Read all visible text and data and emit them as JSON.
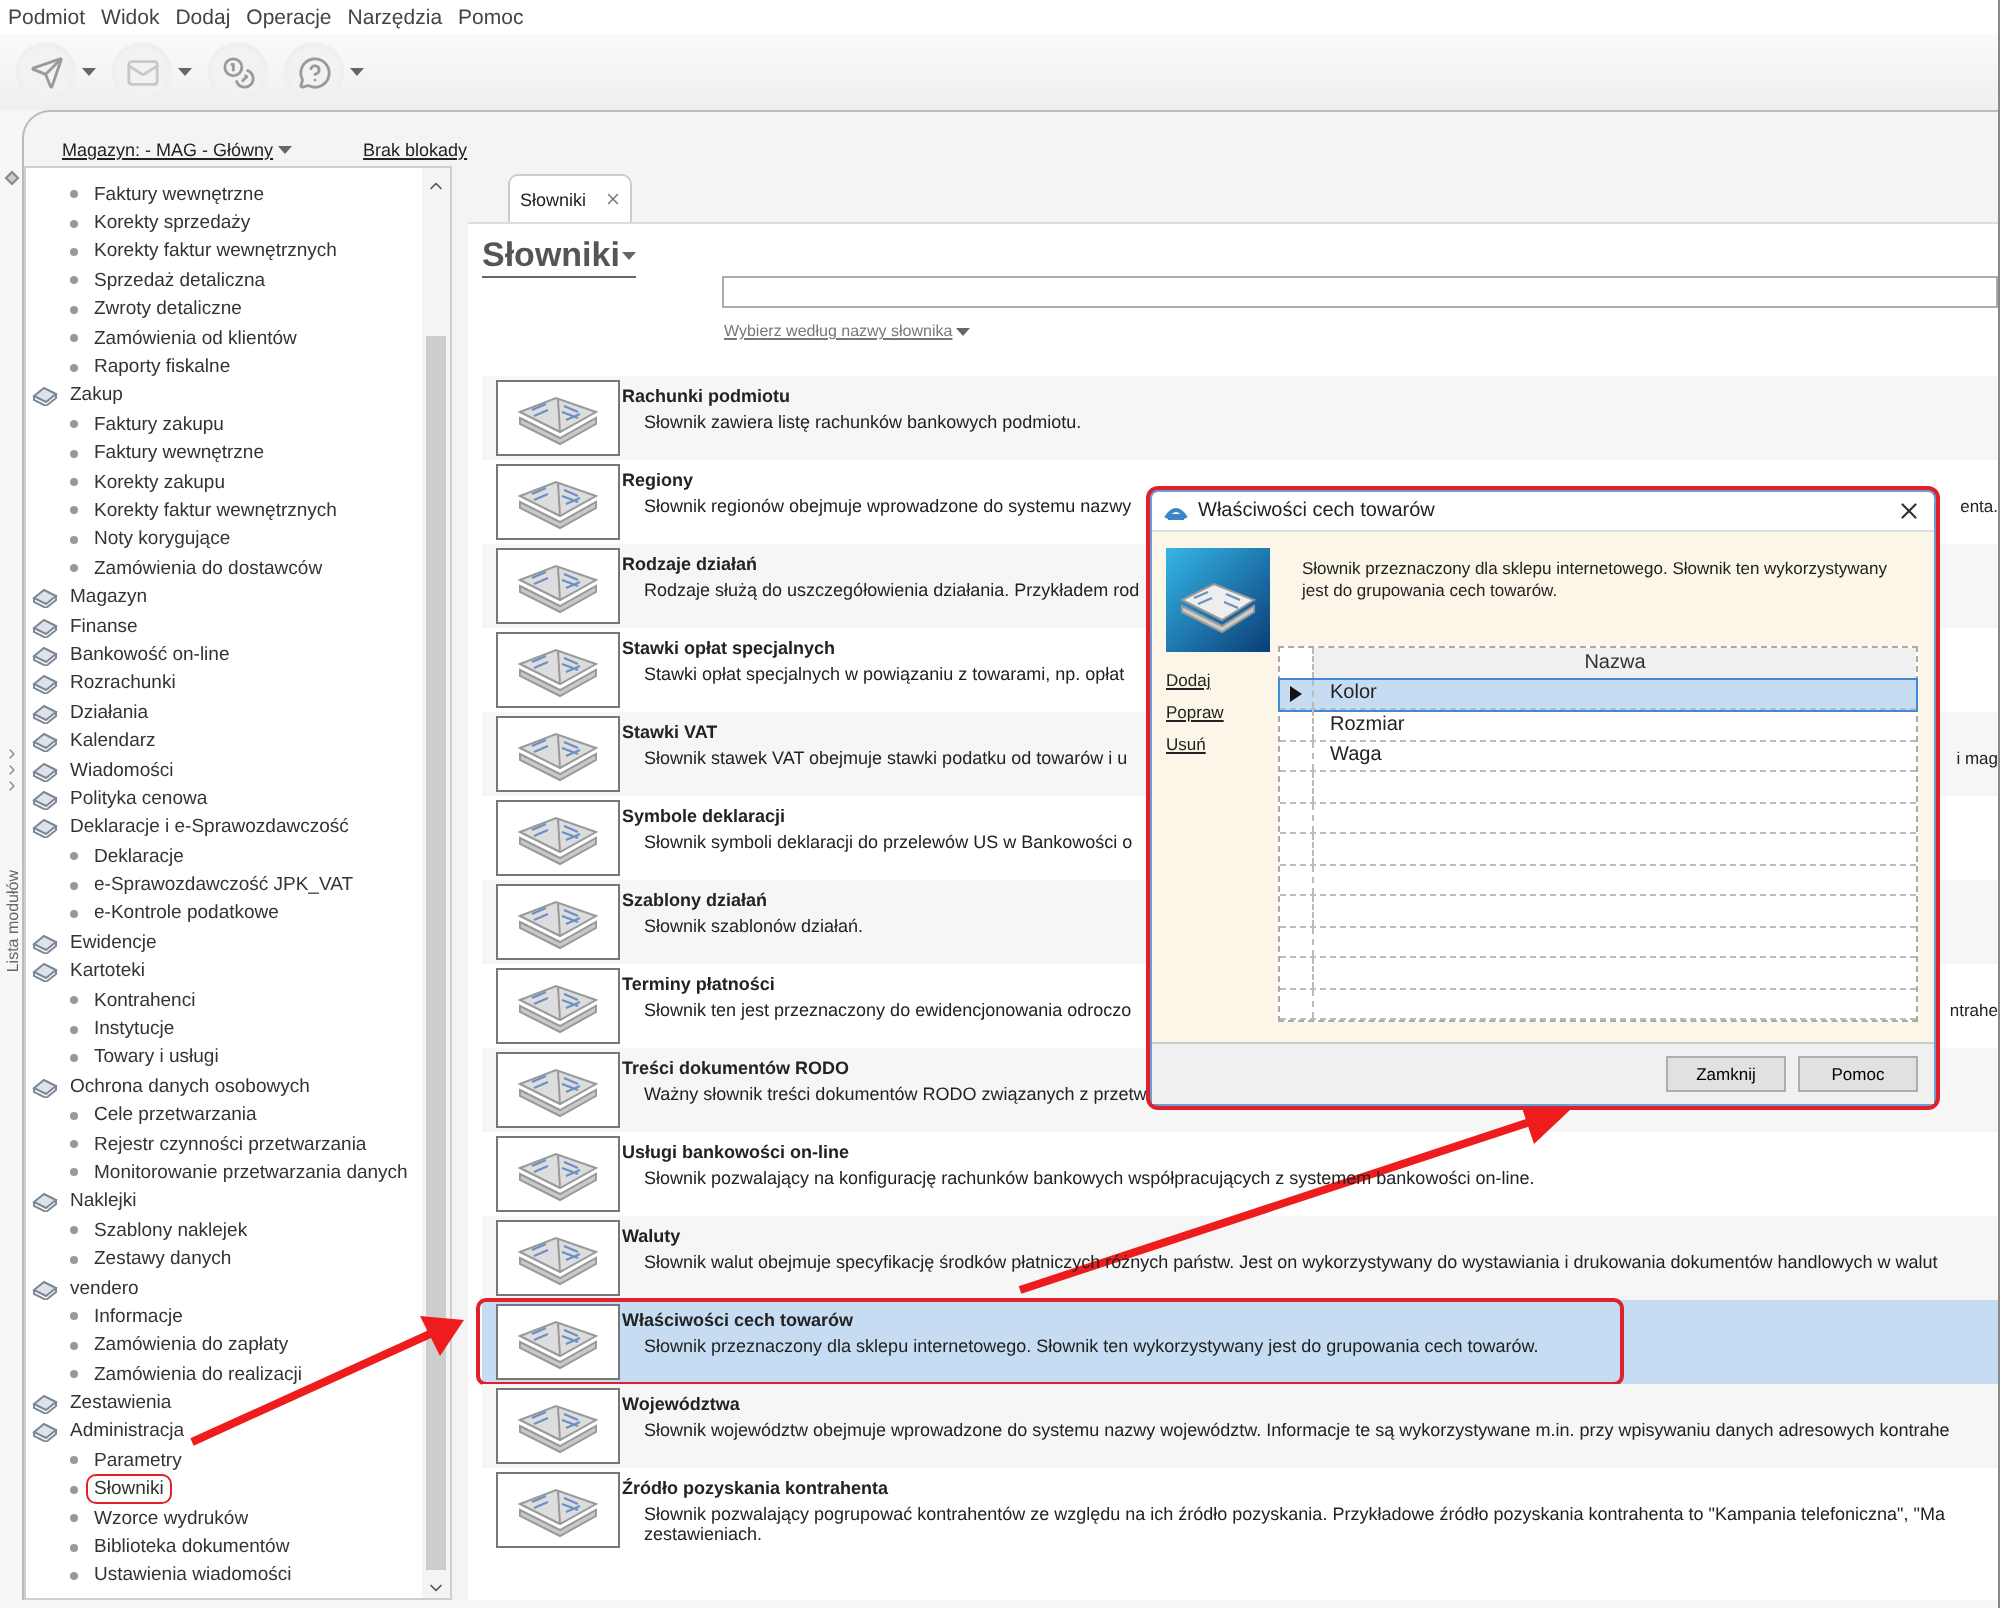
{
  "menu": [
    "Podmiot",
    "Widok",
    "Dodaj",
    "Operacje",
    "Narzędzia",
    "Pomoc"
  ],
  "toolbar": [
    {
      "kind": "send",
      "dropdown": true,
      "disabled": false
    },
    {
      "kind": "mail",
      "dropdown": true,
      "disabled": true
    },
    {
      "kind": "coins",
      "dropdown": false,
      "disabled": false
    },
    {
      "kind": "help",
      "dropdown": true,
      "disabled": false
    }
  ],
  "infobar": {
    "warehouse": "Magazyn: - MAG - Główny",
    "lock": "Brak blokady"
  },
  "sidebar": {
    "title": "Lista modułów",
    "tree": [
      {
        "children": [
          {
            "label": "Faktury wewnętrzne"
          },
          {
            "label": "Korekty sprzedaży"
          },
          {
            "label": "Korekty faktur wewnętrznych"
          },
          {
            "label": "Sprzedaż detaliczna"
          },
          {
            "label": "Zwroty detaliczne"
          },
          {
            "label": "Zamówienia od klientów"
          },
          {
            "label": "Raporty fiskalne"
          }
        ]
      },
      {
        "label": "Zakup",
        "children": [
          {
            "label": "Faktury zakupu"
          },
          {
            "label": "Faktury wewnętrzne"
          },
          {
            "label": "Korekty zakupu"
          },
          {
            "label": "Korekty faktur wewnętrznych"
          },
          {
            "label": "Noty korygujące"
          },
          {
            "label": "Zamówienia do dostawców"
          }
        ]
      },
      {
        "label": "Magazyn"
      },
      {
        "label": "Finanse"
      },
      {
        "label": "Bankowość on-line"
      },
      {
        "label": "Rozrachunki"
      },
      {
        "label": "Działania"
      },
      {
        "label": "Kalendarz"
      },
      {
        "label": "Wiadomości"
      },
      {
        "label": "Polityka cenowa"
      },
      {
        "label": "Deklaracje i e-Sprawozdawczość",
        "children": [
          {
            "label": "Deklaracje"
          },
          {
            "label": "e-Sprawozdawczość JPK_VAT"
          },
          {
            "label": "e-Kontrole podatkowe"
          }
        ]
      },
      {
        "label": "Ewidencje"
      },
      {
        "label": "Kartoteki",
        "children": [
          {
            "label": "Kontrahenci"
          },
          {
            "label": "Instytucje"
          },
          {
            "label": "Towary i usługi"
          }
        ]
      },
      {
        "label": "Ochrona danych osobowych",
        "children": [
          {
            "label": "Cele przetwarzania"
          },
          {
            "label": "Rejestr czynności przetwarzania"
          },
          {
            "label": "Monitorowanie przetwarzania danych"
          }
        ]
      },
      {
        "label": "Naklejki",
        "children": [
          {
            "label": "Szablony naklejek"
          },
          {
            "label": "Zestawy danych"
          }
        ]
      },
      {
        "label": "vendero",
        "children": [
          {
            "label": "Informacje"
          },
          {
            "label": "Zamówienia do zapłaty"
          },
          {
            "label": "Zamówienia do realizacji"
          }
        ]
      },
      {
        "label": "Zestawienia"
      },
      {
        "label": "Administracja",
        "children": [
          {
            "label": "Parametry"
          },
          {
            "label": "Słowniki",
            "highlighted": true
          },
          {
            "label": "Wzorce wydruków"
          },
          {
            "label": "Biblioteka dokumentów"
          },
          {
            "label": "Ustawienia wiadomości"
          }
        ]
      }
    ]
  },
  "tabs": [
    {
      "label": "Słowniki",
      "selected": true
    }
  ],
  "page": {
    "title": "Słowniki",
    "filter_link": "Wybierz według nazwy słownika"
  },
  "dictionaries": [
    {
      "name": "Rachunki podmiotu",
      "lines": [
        "Słownik zawiera listę rachunków bankowych podmiotu."
      ],
      "selected": false,
      "highlighted": false
    },
    {
      "name": "Regiony",
      "lines": [
        "Słownik regionów obejmuje wprowadzone do systemu nazwy"
      ],
      "tail": "enta.",
      "selected": false,
      "highlighted": false
    },
    {
      "name": "Rodzaje działań",
      "lines": [
        "Rodzaje służą do uszczegółowienia działania. Przykładem rod"
      ],
      "selected": false,
      "highlighted": false
    },
    {
      "name": "Stawki opłat specjalnych",
      "lines": [
        "Stawki opłat specjalnych w powiązaniu z towarami, np. opłat"
      ],
      "selected": false,
      "highlighted": false
    },
    {
      "name": "Stawki VAT",
      "lines": [
        "Słownik stawek VAT obejmuje stawki podatku od towarów i u"
      ],
      "tail": "i mag",
      "selected": false,
      "highlighted": false
    },
    {
      "name": "Symbole deklaracji",
      "lines": [
        "Słownik symboli deklaracji do przelewów US w Bankowości o"
      ],
      "selected": false,
      "highlighted": false
    },
    {
      "name": "Szablony działań",
      "lines": [
        "Słownik szablonów działań."
      ],
      "selected": false,
      "highlighted": false
    },
    {
      "name": "Terminy płatności",
      "lines": [
        "Słownik ten jest przeznaczony do ewidencjonowania odroczo"
      ],
      "tail": "ntrahe",
      "selected": false,
      "highlighted": false
    },
    {
      "name": "Treści dokumentów RODO",
      "lines": [
        "Ważny słownik treści dokumentów RODO związanych z przetw"
      ],
      "selected": false,
      "highlighted": false
    },
    {
      "name": "Usługi bankowości on-line",
      "lines": [
        "Słownik pozwalający na konfigurację rachunków bankowych współpracujących z systemem bankowości on-line."
      ],
      "selected": false,
      "highlighted": false
    },
    {
      "name": "Waluty",
      "lines": [
        "Słownik walut obejmuje specyfikację środków płatniczych różnych państw. Jest on wykorzystywany do wystawiania i drukowania dokumentów handlowych w walut"
      ],
      "selected": false,
      "highlighted": false
    },
    {
      "name": "Właściwości cech towarów",
      "lines": [
        "Słownik przeznaczony dla sklepu internetowego. Słownik ten wykorzystywany jest do grupowania cech towarów."
      ],
      "selected": true,
      "highlighted": true
    },
    {
      "name": "Województwa",
      "lines": [
        "Słownik województw obejmuje wprowadzone do systemu nazwy województw. Informacje te są wykorzystywane m.in. przy wpisywaniu danych adresowych kontrahe"
      ],
      "selected": false,
      "highlighted": false
    },
    {
      "name": "Źródło pozyskania kontrahenta",
      "lines": [
        "Słownik pozwalający pogrupować kontrahentów ze względu na ich źródło pozyskania. Przykładowe źródło pozyskania kontrahenta to \"Kampania telefoniczna\", \"Ma",
        "zestawieniach."
      ],
      "selected": false,
      "highlighted": false
    }
  ],
  "dialog": {
    "title": "Właściwości cech towarów",
    "highlighted": true,
    "description": "Słownik przeznaczony dla sklepu internetowego. Słownik ten wykorzystywany jest do grupowania cech towarów.",
    "actions": [
      "Dodaj",
      "Popraw",
      "Usuń"
    ],
    "column": "Nazwa",
    "rows": [
      {
        "name": "Kolor",
        "selected": true
      },
      {
        "name": "Rozmiar",
        "selected": false
      },
      {
        "name": "Waga",
        "selected": false
      }
    ],
    "buttons": [
      "Zamknij",
      "Pomoc"
    ]
  }
}
